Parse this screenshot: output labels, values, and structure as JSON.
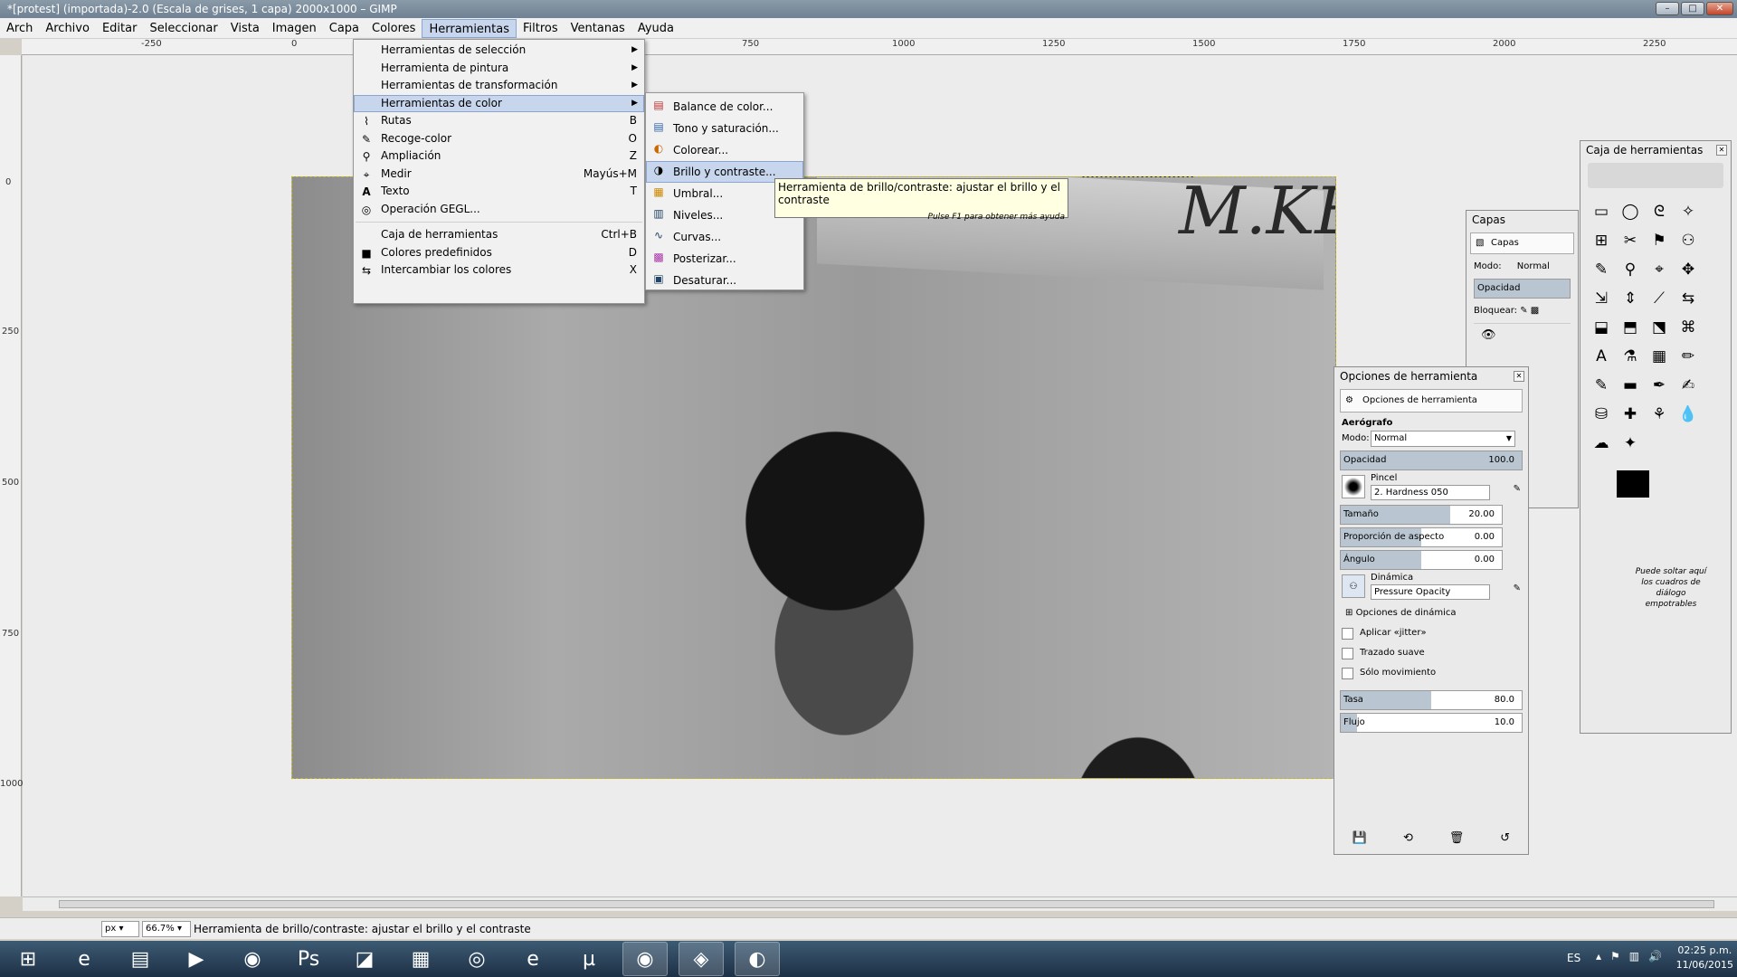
{
  "window": {
    "title": "*[protest] (importada)-2.0 (Escala de grises, 1 capa) 2000x1000 – GIMP",
    "min": "–",
    "max": "□",
    "close": "✕"
  },
  "menubar": [
    "Arch",
    "Archivo",
    "Editar",
    "Seleccionar",
    "Vista",
    "Imagen",
    "Capa",
    "Colores",
    "Herramientas",
    "Filtros",
    "Ventanas",
    "Ayuda"
  ],
  "ruler": {
    "top": [
      "-250",
      "0",
      "250",
      "500",
      "750",
      "1000",
      "1250",
      "1500",
      "1750",
      "2000",
      "2250"
    ],
    "left": [
      "0",
      "250",
      "500",
      "750",
      "1000"
    ]
  },
  "image": {
    "sign_text": "M.KE"
  },
  "tools_menu": {
    "items": [
      {
        "label": "Herramientas de selección",
        "sc": "",
        "sub": true
      },
      {
        "label": "Herramienta de pintura",
        "sc": "",
        "sub": true
      },
      {
        "label": "Herramientas de transformación",
        "sc": "",
        "sub": true
      },
      {
        "label": "Herramientas de color",
        "sc": "",
        "sub": true
      },
      {
        "label": "Rutas",
        "sc": "B",
        "icon": "⌇"
      },
      {
        "label": "Recoge-color",
        "sc": "O",
        "icon": "✎"
      },
      {
        "label": "Ampliación",
        "sc": "Z",
        "icon": "⚲"
      },
      {
        "label": "Medir",
        "sc": "Mayús+M",
        "icon": "⌖"
      },
      {
        "label": "Texto",
        "sc": "T",
        "icon": "A"
      },
      {
        "label": "Operación GEGL...",
        "sc": "",
        "icon": "◎"
      },
      {
        "label": "Caja de herramientas",
        "sc": "Ctrl+B"
      },
      {
        "label": "Colores predefinidos",
        "sc": "D",
        "icon": "■"
      },
      {
        "label": "Intercambiar los colores",
        "sc": "X",
        "icon": "⇆"
      }
    ]
  },
  "color_menu": {
    "items": [
      {
        "label": "Balance de color...",
        "icon": "▤"
      },
      {
        "label": "Tono y saturación...",
        "icon": "▤"
      },
      {
        "label": "Colorear...",
        "icon": "◐"
      },
      {
        "label": "Brillo y contraste...",
        "icon": "◑"
      },
      {
        "label": "Umbral...",
        "icon": "▦"
      },
      {
        "label": "Niveles...",
        "icon": "▥"
      },
      {
        "label": "Curvas...",
        "icon": "∿"
      },
      {
        "label": "Posterizar...",
        "icon": "▩"
      },
      {
        "label": "Desaturar...",
        "icon": "▣"
      }
    ]
  },
  "tooltip": {
    "main": "Herramienta de brillo/contraste: ajustar el brillo y el contraste",
    "sub": "Pulse F1 para obtener más ayuda"
  },
  "layers": {
    "title": "Capas",
    "tab": "Capas",
    "mode_label": "Modo:",
    "mode_value": "Normal",
    "opacity_label": "Opacidad",
    "lock_label": "Bloquear:"
  },
  "tool_options": {
    "title": "Opciones de herramienta",
    "tab": "Opciones de herramienta",
    "tool_name": "Aerógrafo",
    "mode_label": "Modo:",
    "mode_value": "Normal",
    "opacity": {
      "label": "Opacidad",
      "value": "100.0",
      "pct": 100
    },
    "brush_label": "Pincel",
    "brush_value": "2. Hardness 050",
    "size": {
      "label": "Tamaño",
      "value": "20.00",
      "pct": 68
    },
    "aspect": {
      "label": "Proporción de aspecto",
      "value": "0.00",
      "pct": 50
    },
    "angle": {
      "label": "Ángulo",
      "value": "0.00",
      "pct": 50
    },
    "dynamics_label": "Dinámica",
    "dynamics_value": "Pressure Opacity",
    "dyn_options": "Opciones de dinámica",
    "checks": [
      "Aplicar «jitter»",
      "Trazado suave",
      "Sólo movimiento"
    ],
    "rate": {
      "label": "Tasa",
      "value": "80.0",
      "pct": 50
    },
    "flow": {
      "label": "Flujo",
      "value": "10.0",
      "pct": 9
    }
  },
  "toolbox": {
    "title": "Caja de herramientas",
    "drop_text": "Puede soltar aquí los cuadros de diálogo empotrables",
    "tools": [
      "▭",
      "◯",
      "ᘓ",
      "✧",
      "⊞",
      "✂",
      "⚑",
      "⚇",
      "✎",
      "⚲",
      "⌖",
      "✥",
      "⇲",
      "⇕",
      "⟋",
      "⇆",
      "⬓",
      "⬒",
      "⬔",
      "⌘",
      "A",
      "⚗",
      "▦",
      "✏",
      "✎",
      "▬",
      "✒",
      "✍",
      "⛁",
      "✚",
      "⚘",
      "💧",
      "☁",
      "✦"
    ]
  },
  "status": {
    "unit": "px",
    "zoom": "66.7%",
    "message": "Herramienta de brillo/contraste: ajustar el brillo y el contraste"
  },
  "taskbar": {
    "lang": "ES",
    "time": "02:25 p.m.",
    "date": "11/06/2015",
    "apps": [
      "⊞",
      "e",
      "▤",
      "▶",
      "◉",
      "Ps",
      "◪",
      "▦",
      "◎",
      "e",
      "µ",
      "◉",
      "◈",
      "◐"
    ]
  }
}
